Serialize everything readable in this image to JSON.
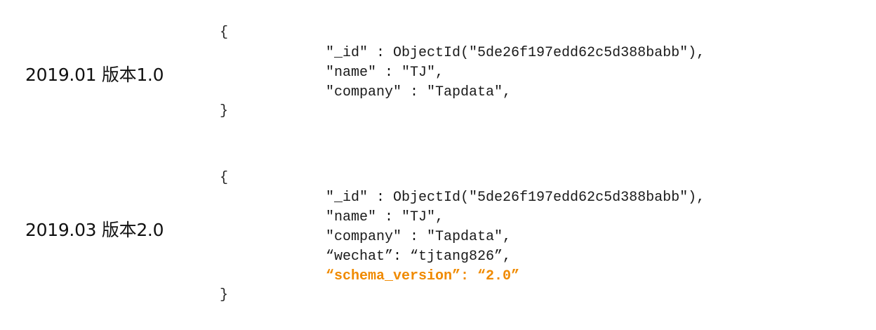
{
  "versions": [
    {
      "label": "2019.01 版本1.0",
      "open_brace": "{",
      "close_brace": "}",
      "lines": [
        {
          "text": "\"_id\" : ObjectId(\"5de26f197edd62c5d388babb\"),",
          "highlight": false
        },
        {
          "text": "\"name\" : \"TJ\",",
          "highlight": false
        },
        {
          "text": "\"company\" : \"Tapdata\",",
          "highlight": false
        }
      ]
    },
    {
      "label": "2019.03 版本2.0",
      "open_brace": "{",
      "close_brace": "}",
      "lines": [
        {
          "text": "\"_id\" : ObjectId(\"5de26f197edd62c5d388babb\"),",
          "highlight": false
        },
        {
          "text": "\"name\" : \"TJ\",",
          "highlight": false
        },
        {
          "text": "\"company\" : \"Tapdata\",",
          "highlight": false
        },
        {
          "text": "“wechat”: “tjtang826”,",
          "highlight": false
        },
        {
          "text": "“schema_version”: “2.0”",
          "highlight": true
        }
      ]
    }
  ],
  "colors": {
    "text": "#1a1a1a",
    "highlight": "#f08a00",
    "background": "#ffffff"
  }
}
